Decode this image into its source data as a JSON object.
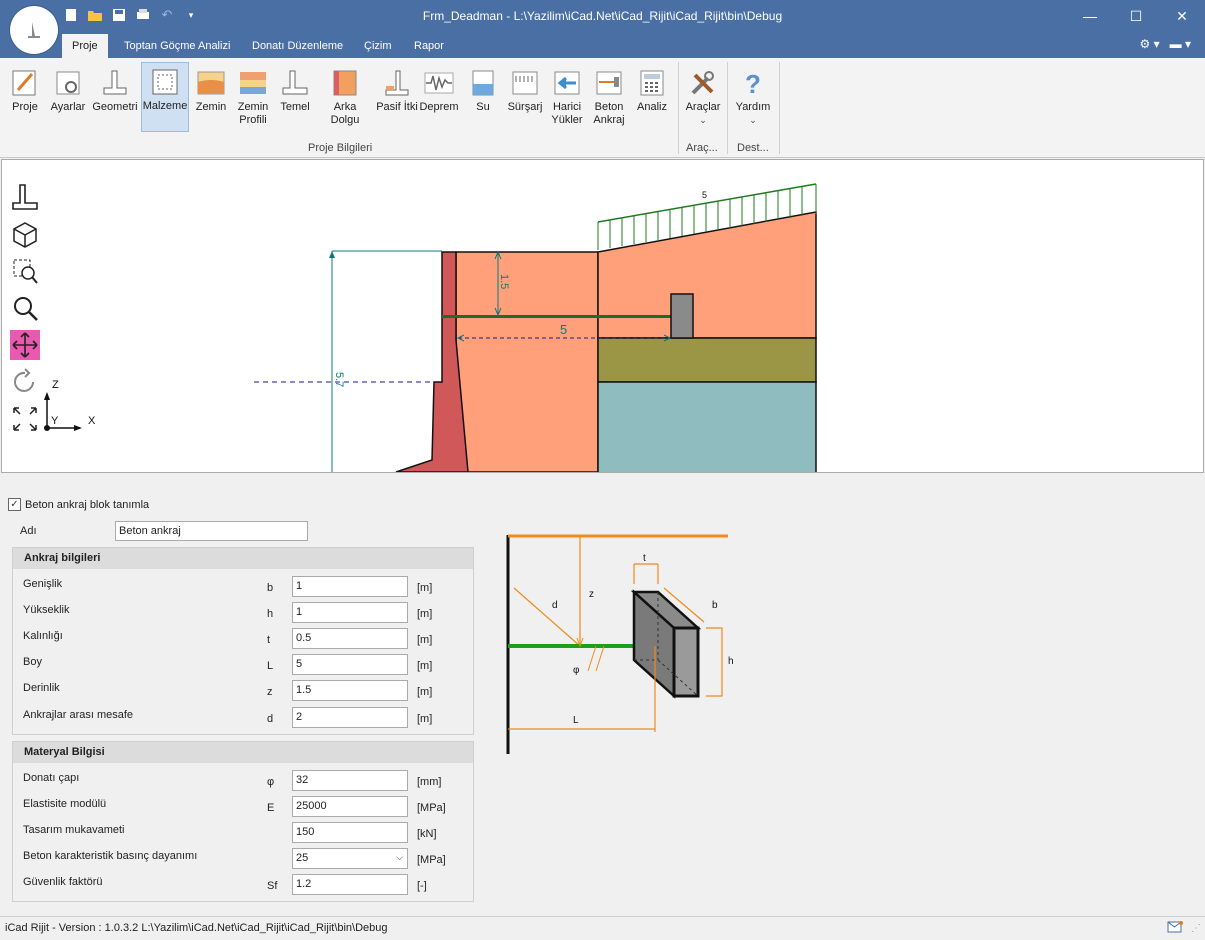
{
  "window": {
    "title": "Frm_Deadman - L:\\Yazilim\\iCad.Net\\iCad_Rijit\\iCad_Rijit\\bin\\Debug"
  },
  "tabs": [
    {
      "label": "Proje",
      "active": true
    },
    {
      "label": "Toptan Göçme Analizi"
    },
    {
      "label": "Donatı Düzenleme"
    },
    {
      "label": "Çizim"
    },
    {
      "label": "Rapor"
    }
  ],
  "ribbon": {
    "buttons": [
      {
        "label": "Proje",
        "icon": "project-icon"
      },
      {
        "label": "Ayarlar",
        "icon": "settings-icon"
      },
      {
        "label": "Geometri",
        "icon": "geometry-icon"
      },
      {
        "label": "Malzeme",
        "icon": "material-icon",
        "selected": true
      },
      {
        "label": "Zemin",
        "icon": "soil-icon"
      },
      {
        "label": "Zemin Profili",
        "icon": "soil-profile-icon"
      },
      {
        "label": "Temel",
        "icon": "foundation-icon"
      },
      {
        "label": "Arka Dolgu",
        "icon": "backfill-icon"
      },
      {
        "label": "Pasif İtki",
        "icon": "passive-thrust-icon"
      },
      {
        "label": "Deprem",
        "icon": "earthquake-icon"
      },
      {
        "label": "Su",
        "icon": "water-icon"
      },
      {
        "label": "Sürşarj",
        "icon": "surcharge-icon"
      },
      {
        "label": "Harici Yükler",
        "icon": "external-loads-icon"
      },
      {
        "label": "Beton Ankraj",
        "icon": "concrete-anchor-icon"
      },
      {
        "label": "Analiz",
        "icon": "analysis-icon"
      }
    ],
    "group_label": "Proje Bilgileri",
    "tools_label": "Araçlar",
    "tools_group": "Araç...",
    "help_label": "Yardım",
    "help_group": "Dest..."
  },
  "drawing": {
    "surcharge_label": "5",
    "depth_label": "1.5",
    "length_label": "5",
    "height_label": "5.7",
    "axis_z": "Z",
    "axis_y": "Y",
    "axis_x": "X",
    "colors": {
      "wall": "#d05858",
      "backfill": "#ffa07a",
      "layer_mid": "#9b9646",
      "layer_low": "#8fbcbf",
      "anchor_rod": "#1f6b2a",
      "dimension": "#0d7a7a",
      "surcharge": "#1f7a1f"
    }
  },
  "form": {
    "define_block_label": "Beton ankraj blok tanımla",
    "define_block_checked": true,
    "name_label": "Adı",
    "name_value": "Beton ankraj",
    "anchor_section": "Ankraj bilgileri",
    "anchor_rows": [
      {
        "label": "Genişlik",
        "symbol": "b",
        "value": "1",
        "unit": "[m]"
      },
      {
        "label": "Yükseklik",
        "symbol": "h",
        "value": "1",
        "unit": "[m]"
      },
      {
        "label": "Kalınlığı",
        "symbol": "t",
        "value": "0.5",
        "unit": "[m]"
      },
      {
        "label": "Boy",
        "symbol": "L",
        "value": "5",
        "unit": "[m]"
      },
      {
        "label": "Derinlik",
        "symbol": "z",
        "value": "1.5",
        "unit": "[m]"
      },
      {
        "label": "Ankrajlar arası mesafe",
        "symbol": "d",
        "value": "2",
        "unit": "[m]"
      }
    ],
    "material_section": "Materyal Bilgisi",
    "material_rows": [
      {
        "label": "Donatı çapı",
        "symbol": "φ",
        "value": "32",
        "unit": "[mm]"
      },
      {
        "label": "Elastisite modülü",
        "symbol": "E",
        "value": "25000",
        "unit": "[MPa]"
      },
      {
        "label": "Tasarım mukavameti",
        "symbol": "",
        "value": "150",
        "unit": "[kN]"
      },
      {
        "label": "Beton karakteristik basınç dayanımı",
        "symbol": "",
        "value": "25",
        "unit": "[MPa]",
        "dropdown": true
      },
      {
        "label": "Güvenlik faktörü",
        "symbol": "Sf",
        "value": "1.2",
        "unit": "[-]"
      }
    ]
  },
  "sketch": {
    "t": "t",
    "b": "b",
    "z": "z",
    "d": "d",
    "h": "h",
    "phi": "φ",
    "L": "L"
  },
  "status": {
    "text": "iCad Rijit - Version : 1.0.3.2  L:\\Yazilim\\iCad.Net\\iCad_Rijit\\iCad_Rijit\\bin\\Debug"
  }
}
